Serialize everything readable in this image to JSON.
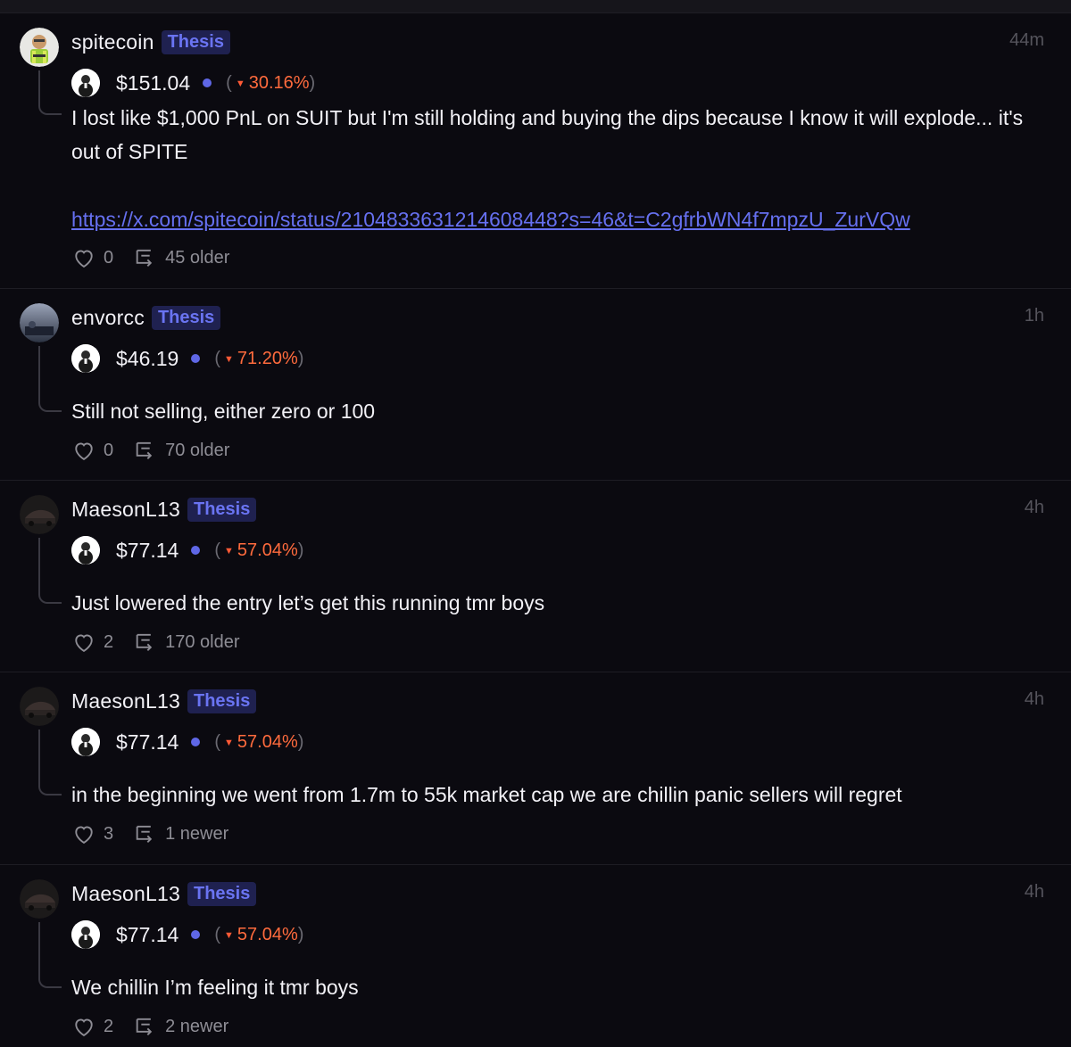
{
  "colors": {
    "background": "#0b0a10",
    "badge_text": "#6a74f2",
    "badge_bg": "#1f2150",
    "link": "#6670f0",
    "negative": "#ff6b3d",
    "dot": "#5f67e6"
  },
  "posts": [
    {
      "username": "spitecoin",
      "badge": "Thesis",
      "time": "44m",
      "price": "$151.04",
      "change_open": "(",
      "change_arrow": "▼",
      "change_pct": "30.16%",
      "change_close": ")",
      "text": "I lost like $1,000 PnL on SUIT but I'm still holding and buying the dips because I know it will explode... it's out of SPITE",
      "link": "https://x.com/spitecoin/status/2104833631214608448?s=46&t=C2gfrbWN4f7mpzU_ZurVQw",
      "likes": "0",
      "thread": "45 older",
      "avatar_icon": "cartoon-character-avatar-icon"
    },
    {
      "username": "envorcc",
      "badge": "Thesis",
      "time": "1h",
      "price": "$46.19",
      "change_open": "(",
      "change_arrow": "▼",
      "change_pct": "71.20%",
      "change_close": ")",
      "text": "Still not selling, either zero or 100",
      "likes": "0",
      "thread": "70 older",
      "avatar_icon": "photo-avatar-icon"
    },
    {
      "username": "MaesonL13",
      "badge": "Thesis",
      "time": "4h",
      "price": "$77.14",
      "change_open": "(",
      "change_arrow": "▼",
      "change_pct": "57.04%",
      "change_close": ")",
      "text": "Just lowered the entry let’s get this running tmr boys",
      "likes": "2",
      "thread": "170 older",
      "avatar_icon": "car-avatar-icon"
    },
    {
      "username": "MaesonL13",
      "badge": "Thesis",
      "time": "4h",
      "price": "$77.14",
      "change_open": "(",
      "change_arrow": "▼",
      "change_pct": "57.04%",
      "change_close": ")",
      "text": "in the beginning we went from 1.7m to 55k market cap we are chillin panic sellers will regret",
      "likes": "3",
      "thread": "1 newer",
      "avatar_icon": "car-avatar-icon"
    },
    {
      "username": "MaesonL13",
      "badge": "Thesis",
      "time": "4h",
      "price": "$77.14",
      "change_open": "(",
      "change_arrow": "▼",
      "change_pct": "57.04%",
      "change_close": ")",
      "text": "We chillin I’m feeling it tmr boys",
      "likes": "2",
      "thread": "2 newer",
      "avatar_icon": "car-avatar-icon"
    }
  ]
}
